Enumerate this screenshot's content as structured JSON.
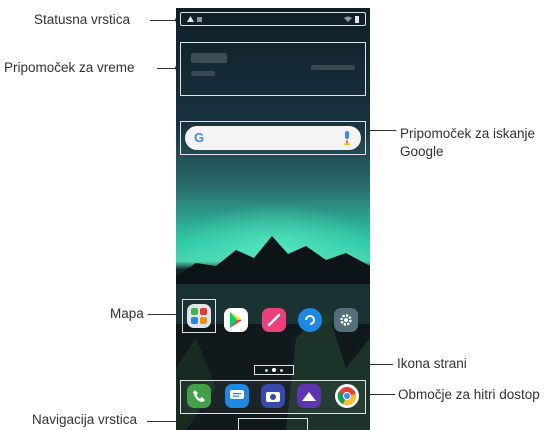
{
  "callouts": {
    "status_bar": "Statusna vrstica",
    "weather_widget": "Pripomoček za vreme",
    "google_search_widget_line1": "Pripomoček za iskanje",
    "google_search_widget_line2": "Google",
    "folder": "Mapa",
    "page_icon": "Ikona strani",
    "quick_access": "Območje za hitri dostop",
    "navigation_bar": "Navigacija vrstica"
  },
  "colors": {
    "sky_top": "#1a2e3a",
    "aurora": "#2fd3b0",
    "mountain": "#0d1519",
    "water": "#203a3f",
    "frame": "#e2e2e2"
  },
  "home_apps": [
    {
      "name": "folder",
      "icon": "folder-icon"
    },
    {
      "name": "play-store",
      "icon": "play-store-icon"
    },
    {
      "name": "notes",
      "icon": "pen-icon"
    },
    {
      "name": "app",
      "icon": "swirl-icon"
    },
    {
      "name": "settings",
      "icon": "gear-icon"
    }
  ],
  "dock_apps": [
    {
      "name": "phone",
      "icon": "phone-icon"
    },
    {
      "name": "messages",
      "icon": "message-icon"
    },
    {
      "name": "camera",
      "icon": "camera-icon"
    },
    {
      "name": "gallery",
      "icon": "mountain-icon"
    },
    {
      "name": "chrome",
      "icon": "chrome-icon"
    }
  ],
  "search": {
    "logo": "G"
  }
}
